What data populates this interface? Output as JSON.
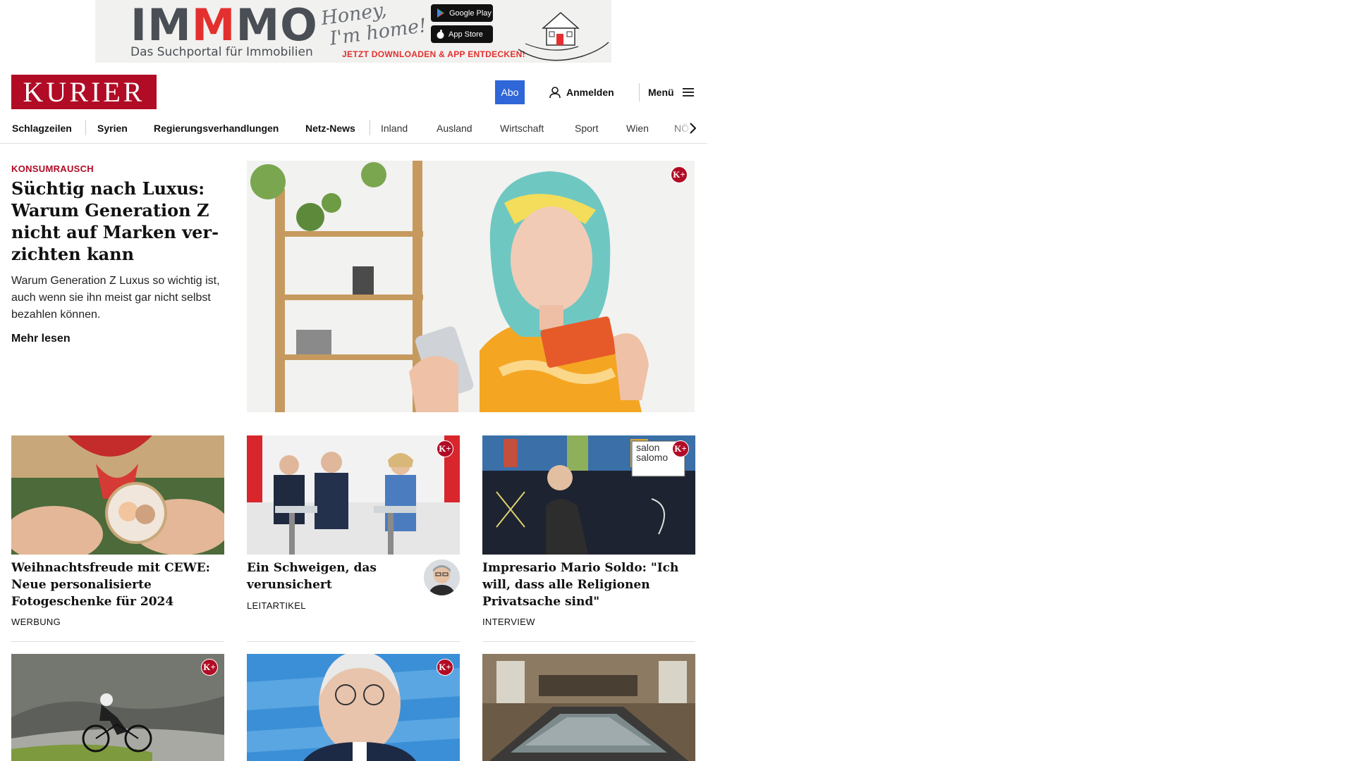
{
  "ad": {
    "logo_part1": "IM",
    "logo_part2": "M",
    "logo_part3": "MO",
    "tagline": "Das Suchportal für Immobilien",
    "script_line1": "Honey,",
    "script_line2": "I'm home!",
    "google_play_label": "Google Play",
    "app_store_label": "App Store",
    "cta": "JETZT DOWNLOADEN & APP ENTDECKEN!",
    "brand_red": "#e3302f"
  },
  "header": {
    "logo": "KURIER",
    "abo_label": "Abo",
    "login_label": "Anmelden",
    "menu_label": "Menü",
    "brand_color": "#b10b25",
    "abo_color": "#2f66d8"
  },
  "nav": {
    "items": [
      {
        "label": "Schlagzeilen"
      },
      {
        "label": "Syrien"
      },
      {
        "label": "Regierungsverhandlungen"
      },
      {
        "label": "Netz-News"
      },
      {
        "label": "Inland"
      },
      {
        "label": "Ausland"
      },
      {
        "label": "Wirtschaft"
      },
      {
        "label": "Sport"
      },
      {
        "label": "Wien"
      },
      {
        "label": "NÖ"
      }
    ]
  },
  "hero": {
    "kicker": "KONSUMRAUSCH",
    "title": "Süchtig nach Luxus: Warum Generation Z nicht auf Marken ver­zichten kann",
    "teaser": "Warum Generation Z Luxus so wichtig ist, auch wenn sie ihn meist gar nicht selbst bezahlen können.",
    "more": "Mehr lesen",
    "badge": "K+"
  },
  "cards": [
    {
      "title": "Weihnachtsfreude mit CEWE: Neue personalisierte Fotogeschenke für 2024",
      "label": "WERBUNG"
    },
    {
      "title": "Ein Schweigen, das verunsichert",
      "label": "LEITARTIKEL",
      "badge": "K+"
    },
    {
      "title": "Impresario Mario Soldo: \"Ich will, dass alle Religionen Privatsache sind\"",
      "label": "INTERVIEW",
      "badge": "K+",
      "overlay_line1": "salon",
      "overlay_line2": "salomo"
    }
  ],
  "bottom_cards": [
    {
      "badge": "K+"
    },
    {
      "badge": "K+"
    },
    {}
  ]
}
